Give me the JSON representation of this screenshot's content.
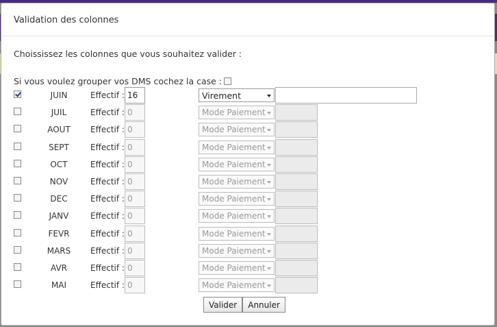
{
  "dialog": {
    "title": "Validation des colonnes",
    "intro": "Choississez les colonnes que vous souhaitez valider :",
    "group_label": "Si vous voulez grouper vos DMS cochez la case :",
    "group_checked": false
  },
  "labels": {
    "effectif": "Effectif :"
  },
  "rows": [
    {
      "month": "JUIN",
      "checked": true,
      "effectif": "16",
      "payment": "Virement",
      "active": true
    },
    {
      "month": "JUIL",
      "checked": false,
      "effectif": "0",
      "payment": "Mode Paiement",
      "active": false
    },
    {
      "month": "AOUT",
      "checked": false,
      "effectif": "0",
      "payment": "Mode Paiement",
      "active": false
    },
    {
      "month": "SEPT",
      "checked": false,
      "effectif": "0",
      "payment": "Mode Paiement",
      "active": false
    },
    {
      "month": "OCT",
      "checked": false,
      "effectif": "0",
      "payment": "Mode Paiement",
      "active": false
    },
    {
      "month": "NOV",
      "checked": false,
      "effectif": "0",
      "payment": "Mode Paiement",
      "active": false
    },
    {
      "month": "DEC",
      "checked": false,
      "effectif": "0",
      "payment": "Mode Paiement",
      "active": false
    },
    {
      "month": "JANV",
      "checked": false,
      "effectif": "0",
      "payment": "Mode Paiement",
      "active": false
    },
    {
      "month": "FEVR",
      "checked": false,
      "effectif": "0",
      "payment": "Mode Paiement",
      "active": false
    },
    {
      "month": "MARS",
      "checked": false,
      "effectif": "0",
      "payment": "Mode Paiement",
      "active": false
    },
    {
      "month": "AVR",
      "checked": false,
      "effectif": "0",
      "payment": "Mode Paiement",
      "active": false
    },
    {
      "month": "MAI",
      "checked": false,
      "effectif": "0",
      "payment": "Mode Paiement",
      "active": false
    }
  ],
  "buttons": {
    "validate": "Valider",
    "cancel": "Annuler"
  }
}
